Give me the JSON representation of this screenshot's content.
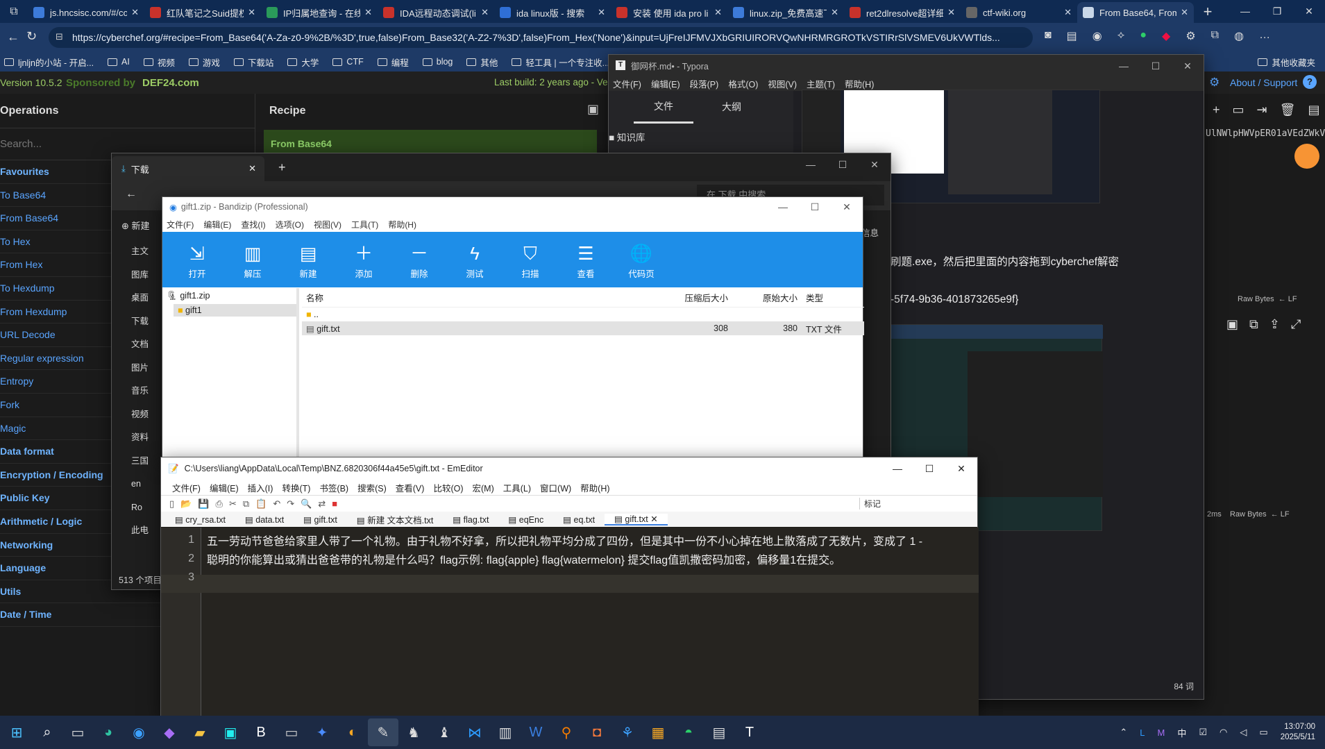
{
  "browser": {
    "tabs": [
      {
        "label": "js.hncsisc.com/#/co",
        "color": "#3d7bd9"
      },
      {
        "label": "红队笔记之Suid提权",
        "color": "#c8322b"
      },
      {
        "label": "IP归属地查询 - 在线",
        "color": "#2a9a5a"
      },
      {
        "label": "IDA远程动态调试(li",
        "color": "#c8322b"
      },
      {
        "label": "ida linux版 - 搜索",
        "color": "#2f6fd6"
      },
      {
        "label": "安装 使用 ida pro li",
        "color": "#c8322b"
      },
      {
        "label": "linux.zip_免费高速下",
        "color": "#3d7bd9"
      },
      {
        "label": "ret2dlresolve超详细",
        "color": "#c8322b"
      },
      {
        "label": "ctf-wiki.org",
        "color": "#666"
      },
      {
        "label": "From Base64, From",
        "color": "#c9d7e8"
      }
    ],
    "url": "https://cyberchef.org/#recipe=From_Base64('A-Za-z0-9%2B/%3D',true,false)From_Base32('A-Z2-7%3D',false)From_Hex('None')&input=UjFreIJFMVJXbGRIUIRORVQwNHRMRGROTkVSTIRrSlVSMEV6UkVWTlds...",
    "bookmarks": [
      "ljnljn的小站 - 开启...",
      "AI",
      "视频",
      "游戏",
      "下载站",
      "大学",
      "CTF",
      "编程",
      "blog",
      "其他",
      "轻工具 | 一个专注收...",
      "其他收藏夹"
    ]
  },
  "cyberchef": {
    "version": "Version 10.5.2",
    "sponsored": "Sponsored by",
    "sponsor": "DEF24.com",
    "last_build": "Last build: 2 years ago - Ve",
    "about": "About / Support",
    "operations_title": "Operations",
    "search_placeholder": "Search...",
    "recipe_title": "Recipe",
    "recipe_op": "From Base64",
    "operations": [
      {
        "label": "Favourites",
        "cat": true
      },
      {
        "label": "To Base64",
        "cat": false
      },
      {
        "label": "From Base64",
        "cat": false
      },
      {
        "label": "To Hex",
        "cat": false
      },
      {
        "label": "From Hex",
        "cat": false
      },
      {
        "label": "To Hexdump",
        "cat": false
      },
      {
        "label": "From Hexdump",
        "cat": false
      },
      {
        "label": "URL Decode",
        "cat": false
      },
      {
        "label": "Regular expression",
        "cat": false
      },
      {
        "label": "Entropy",
        "cat": false
      },
      {
        "label": "Fork",
        "cat": false
      },
      {
        "label": "Magic",
        "cat": false
      },
      {
        "label": "Data format",
        "cat": true
      },
      {
        "label": "Encryption / Encoding",
        "cat": true
      },
      {
        "label": "Public Key",
        "cat": true
      },
      {
        "label": "Arithmetic / Logic",
        "cat": true
      },
      {
        "label": "Networking",
        "cat": true
      },
      {
        "label": "Language",
        "cat": true
      },
      {
        "label": "Utils",
        "cat": true
      },
      {
        "label": "Date / Time",
        "cat": true
      }
    ],
    "input_fragment": "UlNWlpHWVpER01aVEdZWkV",
    "raw_bytes": "Raw Bytes",
    "lf": "LF",
    "time": "2ms"
  },
  "typora": {
    "title": "御网杯.md• - Typora",
    "menu": [
      "文件(F)",
      "编辑(E)",
      "段落(P)",
      "格式(O)",
      "视图(V)",
      "主题(T)",
      "帮助(H)"
    ],
    "side_tabs": [
      "文件",
      "大纲"
    ],
    "tree_item": "知识库",
    "text1": "刷题.exe，然后把里面的内容拖到cyberchef解密",
    "text2": "-5f74-9b36-401873265e9f}",
    "word_count": "84 词"
  },
  "explorer": {
    "title": "下载",
    "search_placeholder": "在 下载 中搜索",
    "new_label": "新建",
    "breadcrumb": "下载",
    "nav": [
      "主文",
      "图库",
      "桌面",
      "下载",
      "文档",
      "图片",
      "音乐",
      "视频",
      "资料",
      "三国",
      "en",
      "Ro",
      "此电"
    ],
    "status": "513 个项目",
    "info": "信息"
  },
  "bandizip": {
    "title": "gift1.zip - Bandizip (Professional)",
    "menu": [
      "文件(F)",
      "编辑(E)",
      "查找(I)",
      "选项(O)",
      "视图(V)",
      "工具(T)",
      "帮助(H)"
    ],
    "toolbar": [
      "打开",
      "解压",
      "新建",
      "添加",
      "删除",
      "测试",
      "扫描",
      "查看",
      "代码页"
    ],
    "tree_root": "gift1.zip",
    "tree_child": "gift1",
    "columns": [
      "名称",
      "压缩后大小",
      "原始大小",
      "类型"
    ],
    "rows": [
      {
        "name": "..",
        "packed": "",
        "size": "",
        "type": ""
      },
      {
        "name": "gift.txt",
        "packed": "308",
        "size": "380",
        "type": "TXT 文件"
      }
    ]
  },
  "emeditor": {
    "title": "C:\\Users\\liang\\AppData\\Local\\Temp\\BNZ.6820306f44a45e5\\gift.txt - EmEditor",
    "menu": [
      "文件(F)",
      "编辑(E)",
      "插入(I)",
      "转换(T)",
      "书签(B)",
      "搜索(S)",
      "查看(V)",
      "比较(O)",
      "宏(M)",
      "工具(L)",
      "窗口(W)",
      "帮助(H)"
    ],
    "mark_label": "标记",
    "tabs": [
      "cry_rsa.txt",
      "data.txt",
      "gift.txt",
      "新建 文本文档.txt",
      "flag.txt",
      "eqEnc",
      "eq.txt",
      "gift.txt"
    ],
    "lines": [
      "五一劳动节爸爸给家里人带了一个礼物。由于礼物不好拿，所以把礼物平均分成了四份，但是其中一份不小心掉在地上散落成了无数片，变成了 1 -",
      "聪明的你能算出或猜出爸爸带的礼物是什么吗？flag示例: flag{apple} flag{watermelon} 提交flag值凯撒密码加密，偏移量1在提交。",
      ""
    ],
    "line_numbers": [
      "1",
      "2",
      "3"
    ]
  },
  "taskbar": {
    "time": "13:07:00",
    "date": "2025/5/11",
    "ime": "中"
  }
}
